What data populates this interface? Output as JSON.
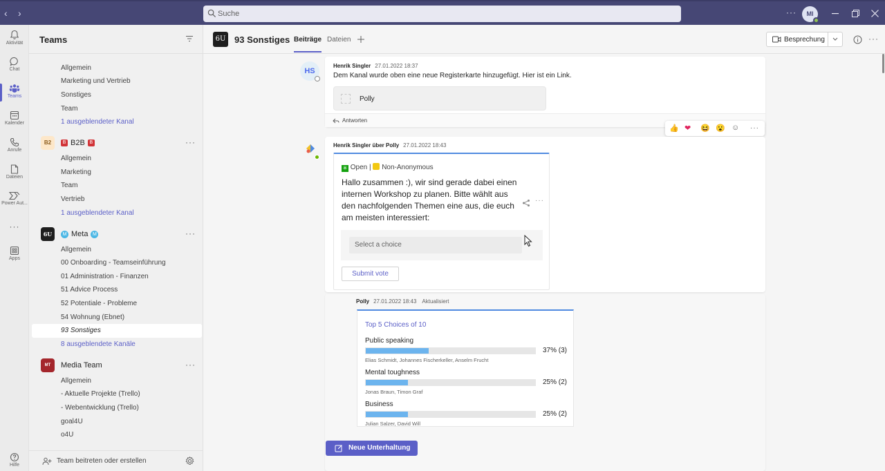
{
  "titlebar": {
    "search_placeholder": "Suche",
    "avatar_initials": "MI"
  },
  "appbar": [
    {
      "label": "Aktivität",
      "icon": "bell-icon"
    },
    {
      "label": "Chat",
      "icon": "chat-icon"
    },
    {
      "label": "Teams",
      "icon": "teams-icon",
      "active": true
    },
    {
      "label": "Kalender",
      "icon": "calendar-icon"
    },
    {
      "label": "Anrufe",
      "icon": "phone-icon"
    },
    {
      "label": "Dateien",
      "icon": "file-icon"
    },
    {
      "label": "Power Aut...",
      "icon": "power-automate-icon"
    },
    {
      "label": "Apps",
      "icon": "apps-icon"
    },
    {
      "label": "Hilfe",
      "icon": "help-icon"
    }
  ],
  "teams_panel": {
    "title": "Teams",
    "team1_channels": [
      "Allgemein",
      "Marketing und Vertrieb",
      "Sonstiges",
      "Team"
    ],
    "team1_hidden": "1 ausgeblendeter Kanal",
    "team2": {
      "avatar": "B2",
      "name": "B2B",
      "channels": [
        "Allgemein",
        "Marketing",
        "Team",
        "Vertrieb"
      ],
      "hidden": "1 ausgeblendeter Kanal"
    },
    "team3": {
      "avatar": "6U",
      "name": "Meta",
      "channels": [
        "Allgemein",
        "00 Onboarding - Teamseinführung",
        "01 Administration - Finanzen",
        "51 Advice Process",
        "52 Potentiale - Probleme",
        "54 Wohnung (Ebnet)",
        "93 Sonstiges"
      ],
      "hidden": "8 ausgeblendete Kanäle"
    },
    "team4": {
      "avatar": "MT",
      "name": "Media Team",
      "channels": [
        "Allgemein",
        "- Aktuelle Projekte (Trello)",
        "- Webentwicklung (Trello)",
        "goal4U",
        "o4U"
      ]
    },
    "footer": "Team beitreten oder erstellen"
  },
  "channel_header": {
    "title": "93 Sonstiges",
    "tabs": [
      "Beiträge",
      "Dateien"
    ],
    "meeting_button": "Besprechung"
  },
  "feed": {
    "post1": {
      "avatar": "HS",
      "author": "Henrik Singler",
      "time": "27.01.2022 18:37",
      "text": "Dem Kanal wurde oben eine neue Registerkarte hinzugefügt. Hier ist ein Link.",
      "tab_card": "Polly",
      "reply": "Antworten"
    },
    "reactions": [
      "👍",
      "❤",
      "😆",
      "😮",
      "☺",
      "···"
    ],
    "post2": {
      "author": "Henrik Singler über Polly",
      "time": "27.01.2022 18:43",
      "status": "Open | ",
      "anonymity": "Non-Anonymous",
      "question": "Hallo zusammen :), wir sind gerade dabei einen internen Workshop zu planen. Bitte wählt aus den nachfolgenden Themen eine aus, die euch am meisten interessiert:",
      "select_placeholder": "Select a choice",
      "submit": "Submit vote"
    },
    "post3": {
      "author": "Polly",
      "time": "27.01.2022 18:43",
      "updated": "Aktualisiert",
      "results_title": "Top 5 Choices of 10",
      "results": [
        {
          "label": "Public speaking",
          "percent": 37,
          "percent_text": "37% (3)",
          "voters": "Elias Schmidt, Johannes Fischerkeller, Anselm Frucht"
        },
        {
          "label": "Mental toughness",
          "percent": 25,
          "percent_text": "25% (2)",
          "voters": "Jonas Braun, Timon Graf"
        },
        {
          "label": "Business",
          "percent": 25,
          "percent_text": "25% (2)",
          "voters": "Julian Salzer, David Will"
        }
      ]
    },
    "new_conversation": "Neue Unterhaltung"
  },
  "colors": {
    "brand": "#5b5fc7",
    "titlebar": "#464775",
    "bar_fill": "#6cb4ee"
  }
}
